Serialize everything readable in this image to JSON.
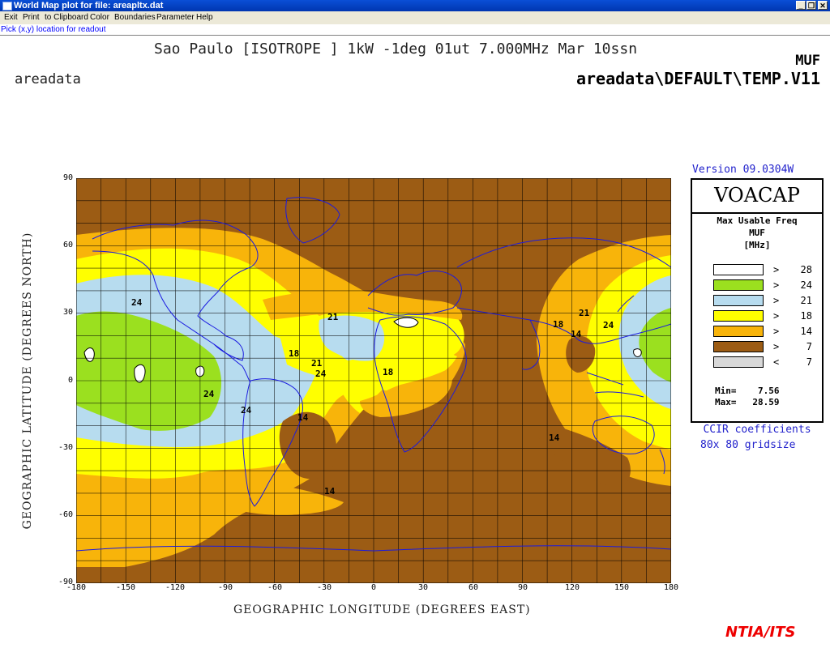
{
  "window": {
    "title": "World Map plot for file: areapltx.dat",
    "buttons": [
      "_",
      "❐",
      "✕"
    ]
  },
  "menu": [
    "Exit",
    "Print",
    "to Clipboard",
    "Color",
    "Boundaries",
    "Parameter",
    "Help"
  ],
  "status_text": "Pick (x,y) location for readout",
  "plot": {
    "title": "Sao Paulo [ISOTROPE ] 1kW -1deg 01ut 7.000MHz Mar 10ssn",
    "measure": "MUF",
    "filepath": "areadata\\DEFAULT\\TEMP.V11",
    "dataset_label": "areadata",
    "ylabel": "GEOGRAPHIC LATITUDE (DEGREES NORTH)",
    "xlabel": "GEOGRAPHIC LONGITUDE (DEGREES EAST)",
    "xticks": [
      "-180",
      "-150",
      "-120",
      "-90",
      "-60",
      "-30",
      "0",
      "30",
      "60",
      "90",
      "120",
      "150",
      "180"
    ],
    "yticks": [
      "90",
      "60",
      "30",
      "0",
      "-30",
      "-60",
      "-90"
    ],
    "contour_labels": [
      "24",
      "21",
      "18",
      "24",
      "24",
      "24",
      "18",
      "21",
      "14",
      "14",
      "18",
      "21",
      "14",
      "24",
      "14"
    ]
  },
  "legend": {
    "version": "Version 09.0304W",
    "brand": "VOACAP",
    "title1": "Max Usable Freq",
    "title2": "MUF",
    "title3": "[MHz]",
    "entries": [
      {
        "color": "#ffffff",
        "cmp": ">",
        "value": "28"
      },
      {
        "color": "#9be01f",
        "cmp": ">",
        "value": "24"
      },
      {
        "color": "#b7dcef",
        "cmp": ">",
        "value": "21"
      },
      {
        "color": "#ffff00",
        "cmp": ">",
        "value": "18"
      },
      {
        "color": "#f8b40a",
        "cmp": ">",
        "value": "14"
      },
      {
        "color": "#9c5c14",
        "cmp": ">",
        "value": "7"
      },
      {
        "color": "#d8d8d8",
        "cmp": "<",
        "value": "7"
      }
    ],
    "min": "Min=    7.56",
    "max": "Max=   28.59",
    "coef": "CCIR coefficients",
    "grid": "80x 80 gridsize"
  },
  "footer": "NTIA/ITS",
  "colors": {
    "brown": "#9c5c14",
    "orange": "#f8b40a",
    "yellow": "#ffff00",
    "lightblue": "#b7dcef",
    "green": "#9be01f",
    "white": "#ffffff",
    "coast": "#1a1ae0",
    "accent_text": "#2222cc",
    "brand_red": "#ee0000"
  }
}
